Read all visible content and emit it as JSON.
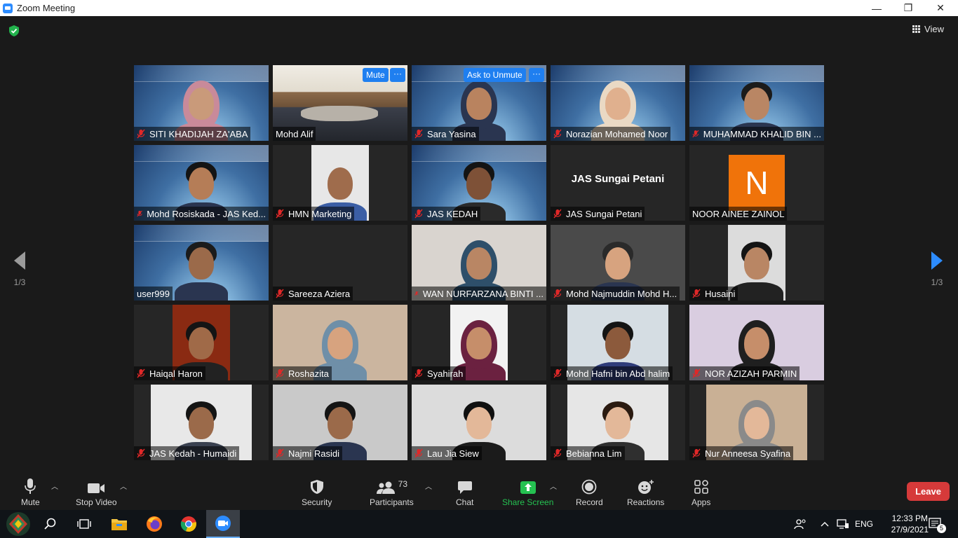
{
  "window": {
    "title": "Zoom Meeting",
    "minimize": "—",
    "restore": "❐",
    "close": "✕"
  },
  "view_label": "View",
  "pager": {
    "prev": "1/3",
    "next": "1/3"
  },
  "active_controls": {
    "mute": "Mute",
    "ask_unmute": "Ask to Unmute",
    "more": "···"
  },
  "tiles": [
    {
      "name": "SITI KHADIJAH ZA'ABA",
      "muted": true
    },
    {
      "name": "Mohd Alif",
      "muted": false
    },
    {
      "name": "Sara Yasina",
      "muted": true
    },
    {
      "name": "Norazian Mohamed Noor",
      "muted": true
    },
    {
      "name": "MUHAMMAD KHALID BIN ...",
      "muted": true
    },
    {
      "name": "Mohd Rosiskada - JAS Ked...",
      "muted": true
    },
    {
      "name": "HMN Marketing",
      "muted": true
    },
    {
      "name": "JAS KEDAH",
      "muted": true
    },
    {
      "name": "JAS Sungai Petani",
      "muted": true,
      "display_name": "JAS Sungai Petani"
    },
    {
      "name": "NOOR AINEE ZAINOL",
      "muted": false,
      "initial": "N"
    },
    {
      "name": "user999",
      "muted": false
    },
    {
      "name": "Sareeza Aziera",
      "muted": true
    },
    {
      "name": "WAN NURFARZANA BINTI ...",
      "muted": true
    },
    {
      "name": "Mohd Najmuddin Mohd H...",
      "muted": true
    },
    {
      "name": "Husaini",
      "muted": true
    },
    {
      "name": "Haiqal Haron",
      "muted": true
    },
    {
      "name": "Roshazita",
      "muted": true
    },
    {
      "name": "Syahirah",
      "muted": true
    },
    {
      "name": "Mohd Hafni bin Abd halim",
      "muted": true
    },
    {
      "name": "NOR AZIZAH PARMIN",
      "muted": true
    },
    {
      "name": "JAS Kedah - Humaidi",
      "muted": true
    },
    {
      "name": "Najmi Rasidi",
      "muted": true
    },
    {
      "name": "Lau Jia Siew",
      "muted": true
    },
    {
      "name": "Bebianna Lim",
      "muted": true
    },
    {
      "name": "Nur Anneesa Syafina",
      "muted": true
    }
  ],
  "toolbar": {
    "mute": "Mute",
    "stop_video": "Stop Video",
    "security": "Security",
    "participants": "Participants",
    "participants_count": "73",
    "chat": "Chat",
    "share_screen": "Share Screen",
    "record": "Record",
    "reactions": "Reactions",
    "apps": "Apps",
    "leave": "Leave"
  },
  "taskbar": {
    "language": "ENG",
    "time": "12:33 PM",
    "date": "27/9/2021",
    "notifications": "5"
  },
  "colors": {
    "accent": "#2d8cff",
    "active_speaker": "#e8f55c",
    "leave": "#d63a3a",
    "share": "#25c151",
    "mic_off": "#e02828"
  }
}
